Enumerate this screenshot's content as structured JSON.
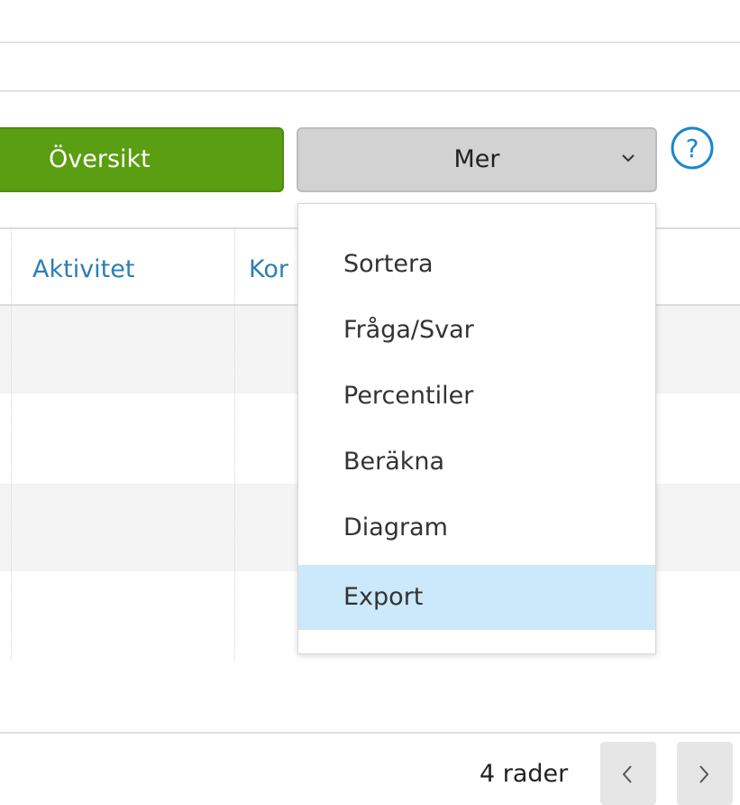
{
  "toolbar": {
    "oversikt_label": "Översikt",
    "mer_label": "Mer",
    "help_glyph": "?"
  },
  "table": {
    "columns": [
      "Aktivitet",
      "Kor"
    ]
  },
  "dropdown": {
    "items": [
      "Sortera",
      "Fråga/Svar",
      "Percentiler",
      "Beräkna",
      "Diagram",
      "Export"
    ],
    "highlighted": "Export"
  },
  "footer": {
    "row_count": "4 rader"
  },
  "icons": {
    "help": "question-circle-icon",
    "dropdown": "chevron-down-icon",
    "prev": "chevron-left-icon",
    "next": "chevron-right-icon"
  },
  "colors": {
    "primary_green": "#5a9e11",
    "link_blue": "#2a7fb8",
    "highlight": "#cce8fb"
  }
}
